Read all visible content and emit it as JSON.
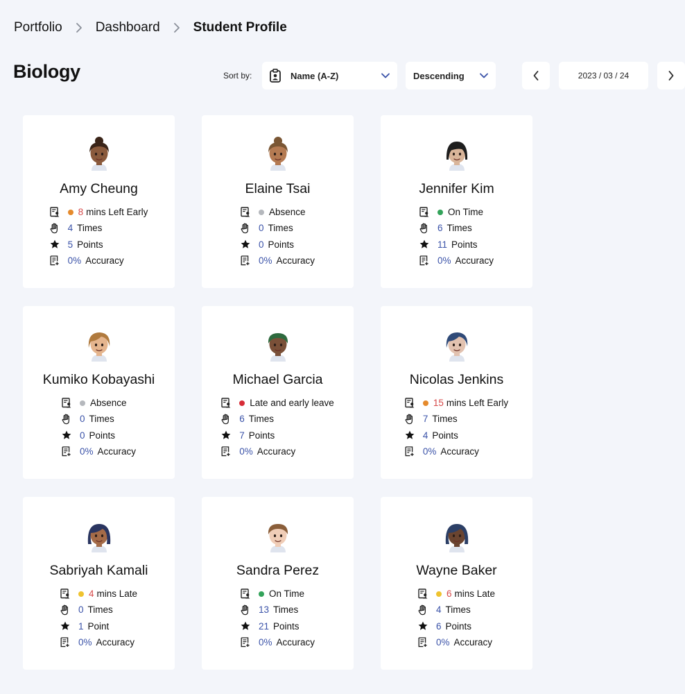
{
  "breadcrumb": [
    "Portfolio",
    "Dashboard",
    "Student Profile"
  ],
  "title": "Biology",
  "sort": {
    "label": "Sort by:",
    "field": "Name (A-Z)",
    "order": "Descending"
  },
  "date": "2023 / 03 / 24",
  "colors": {
    "absence": "#b5b8bd",
    "on_time": "#33a35a",
    "left_early": "#e58a2c",
    "late": "#efc32f",
    "late_early": "#d72c37",
    "accent_number": "#3a52a8",
    "late_number": "#d64949"
  },
  "students": [
    {
      "name": "Amy Cheung",
      "status_number": "8",
      "status_text": "mins Left Early",
      "status_type": "left_early",
      "times": "4",
      "times_label": "Times",
      "points": "5",
      "points_label": "Points",
      "accuracy": "0%",
      "accuracy_label": "Accuracy"
    },
    {
      "name": "Elaine Tsai",
      "status_number": "",
      "status_text": "Absence",
      "status_type": "absence",
      "times": "0",
      "times_label": "Times",
      "points": "0",
      "points_label": "Points",
      "accuracy": "0%",
      "accuracy_label": "Accuracy"
    },
    {
      "name": "Jennifer Kim",
      "status_number": "",
      "status_text": "On Time",
      "status_type": "on_time",
      "times": "6",
      "times_label": "Times",
      "points": "11",
      "points_label": "Points",
      "accuracy": "0%",
      "accuracy_label": "Accuracy"
    },
    {
      "name": "Kumiko Kobayashi",
      "status_number": "",
      "status_text": "Absence",
      "status_type": "absence",
      "times": "0",
      "times_label": "Times",
      "points": "0",
      "points_label": "Points",
      "accuracy": "0%",
      "accuracy_label": "Accuracy"
    },
    {
      "name": "Michael Garcia",
      "status_number": "",
      "status_text": "Late and early leave",
      "status_type": "late_early",
      "times": "6",
      "times_label": "Times",
      "points": "7",
      "points_label": "Points",
      "accuracy": "0%",
      "accuracy_label": "Accuracy"
    },
    {
      "name": "Nicolas Jenkins",
      "status_number": "15",
      "status_text": "mins Left Early",
      "status_type": "left_early",
      "times": "7",
      "times_label": "Times",
      "points": "4",
      "points_label": "Points",
      "accuracy": "0%",
      "accuracy_label": "Accuracy"
    },
    {
      "name": "Sabriyah Kamali",
      "status_number": "4",
      "status_text": "mins Late",
      "status_type": "late",
      "times": "0",
      "times_label": "Times",
      "points": "1",
      "points_label": "Point",
      "accuracy": "0%",
      "accuracy_label": "Accuracy"
    },
    {
      "name": "Sandra Perez",
      "status_number": "",
      "status_text": "On Time",
      "status_type": "on_time",
      "times": "13",
      "times_label": "Times",
      "points": "21",
      "points_label": "Points",
      "accuracy": "0%",
      "accuracy_label": "Accuracy"
    },
    {
      "name": "Wayne Baker",
      "status_number": "6",
      "status_text": "mins Late",
      "status_type": "late",
      "times": "4",
      "times_label": "Times",
      "points": "6",
      "points_label": "Points",
      "accuracy": "0%",
      "accuracy_label": "Accuracy"
    }
  ],
  "avatars": [
    {
      "skin": "#8a5a3c",
      "hair": "#3a2418",
      "style": "bun"
    },
    {
      "skin": "#b47a52",
      "hair": "#7a5634",
      "style": "bun"
    },
    {
      "skin": "#d9b59a",
      "hair": "#1e1e1e",
      "style": "straight"
    },
    {
      "skin": "#e5b58e",
      "hair": "#b07a3e",
      "style": "side"
    },
    {
      "skin": "#7a5038",
      "hair": "#2e6a3e",
      "style": "short"
    },
    {
      "skin": "#e2c2b0",
      "hair": "#2f4a78",
      "style": "side"
    },
    {
      "skin": "#a46b48",
      "hair": "#2a3560",
      "style": "bob"
    },
    {
      "skin": "#f0cdb7",
      "hair": "#8a5e3a",
      "style": "short"
    },
    {
      "skin": "#6a4430",
      "hair": "#2c3f66",
      "style": "bob"
    }
  ]
}
